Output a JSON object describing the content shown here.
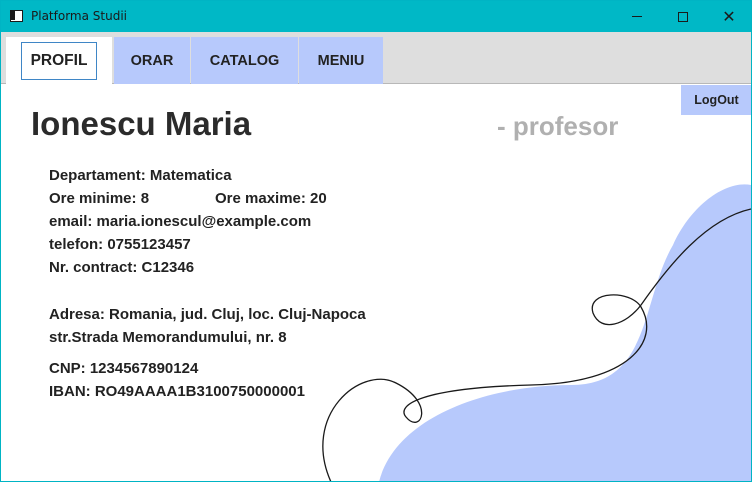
{
  "window": {
    "title": "Platforma Studii"
  },
  "tabs": [
    {
      "label": "PROFIL",
      "active": true
    },
    {
      "label": "ORAR",
      "active": false
    },
    {
      "label": "CATALOG",
      "active": false
    },
    {
      "label": "MENIU",
      "active": false
    }
  ],
  "logout_label": "LogOut",
  "profile": {
    "name": "Ionescu Maria",
    "role": "- profesor",
    "department": "Departament: Matematica",
    "min_hours": "Ore minime: 8",
    "max_hours": "Ore maxime: 20",
    "email": "email: maria.ionescul@example.com",
    "phone": "telefon: 0755123457",
    "contract": "Nr. contract: C12346",
    "address_line1": "Adresa: Romania, jud. Cluj, loc. Cluj-Napoca",
    "address_line2": "str.Strada Memorandumului, nr. 8",
    "cnp": "CNP: 1234567890124",
    "iban": "IBAN: RO49AAAA1B3100750000001"
  },
  "colors": {
    "titlebar": "#00b8c6",
    "accent_blue": "#b7c9fc",
    "tabbar_bg": "#dedede",
    "role_gray": "#b0b0b0",
    "focus_border": "#3f86c6"
  },
  "icons": {
    "app": "window-app-icon",
    "minimize": "minimize-icon",
    "maximize": "maximize-icon",
    "close": "close-icon"
  }
}
